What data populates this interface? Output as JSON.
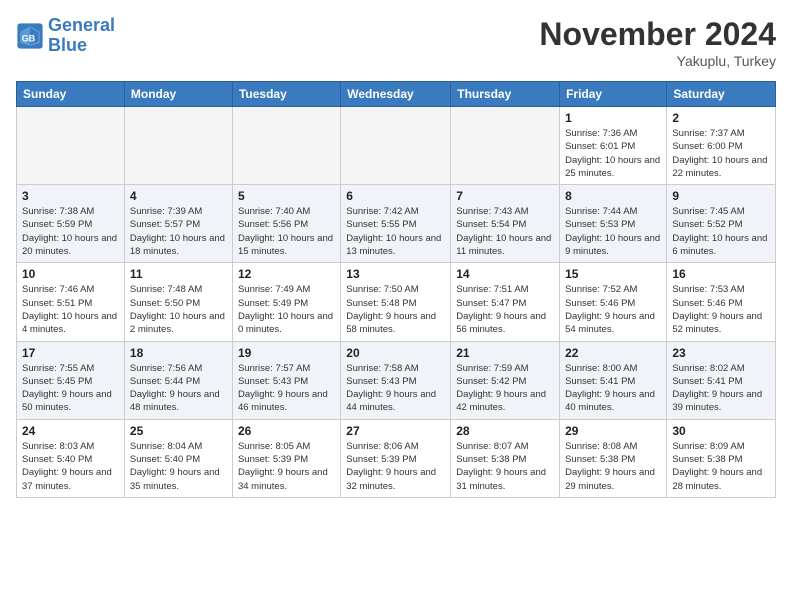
{
  "header": {
    "logo_line1": "General",
    "logo_line2": "Blue",
    "month_title": "November 2024",
    "location": "Yakuplu, Turkey"
  },
  "weekdays": [
    "Sunday",
    "Monday",
    "Tuesday",
    "Wednesday",
    "Thursday",
    "Friday",
    "Saturday"
  ],
  "weeks": [
    [
      {
        "day": "",
        "info": ""
      },
      {
        "day": "",
        "info": ""
      },
      {
        "day": "",
        "info": ""
      },
      {
        "day": "",
        "info": ""
      },
      {
        "day": "",
        "info": ""
      },
      {
        "day": "1",
        "info": "Sunrise: 7:36 AM\nSunset: 6:01 PM\nDaylight: 10 hours and 25 minutes."
      },
      {
        "day": "2",
        "info": "Sunrise: 7:37 AM\nSunset: 6:00 PM\nDaylight: 10 hours and 22 minutes."
      }
    ],
    [
      {
        "day": "3",
        "info": "Sunrise: 7:38 AM\nSunset: 5:59 PM\nDaylight: 10 hours and 20 minutes."
      },
      {
        "day": "4",
        "info": "Sunrise: 7:39 AM\nSunset: 5:57 PM\nDaylight: 10 hours and 18 minutes."
      },
      {
        "day": "5",
        "info": "Sunrise: 7:40 AM\nSunset: 5:56 PM\nDaylight: 10 hours and 15 minutes."
      },
      {
        "day": "6",
        "info": "Sunrise: 7:42 AM\nSunset: 5:55 PM\nDaylight: 10 hours and 13 minutes."
      },
      {
        "day": "7",
        "info": "Sunrise: 7:43 AM\nSunset: 5:54 PM\nDaylight: 10 hours and 11 minutes."
      },
      {
        "day": "8",
        "info": "Sunrise: 7:44 AM\nSunset: 5:53 PM\nDaylight: 10 hours and 9 minutes."
      },
      {
        "day": "9",
        "info": "Sunrise: 7:45 AM\nSunset: 5:52 PM\nDaylight: 10 hours and 6 minutes."
      }
    ],
    [
      {
        "day": "10",
        "info": "Sunrise: 7:46 AM\nSunset: 5:51 PM\nDaylight: 10 hours and 4 minutes."
      },
      {
        "day": "11",
        "info": "Sunrise: 7:48 AM\nSunset: 5:50 PM\nDaylight: 10 hours and 2 minutes."
      },
      {
        "day": "12",
        "info": "Sunrise: 7:49 AM\nSunset: 5:49 PM\nDaylight: 10 hours and 0 minutes."
      },
      {
        "day": "13",
        "info": "Sunrise: 7:50 AM\nSunset: 5:48 PM\nDaylight: 9 hours and 58 minutes."
      },
      {
        "day": "14",
        "info": "Sunrise: 7:51 AM\nSunset: 5:47 PM\nDaylight: 9 hours and 56 minutes."
      },
      {
        "day": "15",
        "info": "Sunrise: 7:52 AM\nSunset: 5:46 PM\nDaylight: 9 hours and 54 minutes."
      },
      {
        "day": "16",
        "info": "Sunrise: 7:53 AM\nSunset: 5:46 PM\nDaylight: 9 hours and 52 minutes."
      }
    ],
    [
      {
        "day": "17",
        "info": "Sunrise: 7:55 AM\nSunset: 5:45 PM\nDaylight: 9 hours and 50 minutes."
      },
      {
        "day": "18",
        "info": "Sunrise: 7:56 AM\nSunset: 5:44 PM\nDaylight: 9 hours and 48 minutes."
      },
      {
        "day": "19",
        "info": "Sunrise: 7:57 AM\nSunset: 5:43 PM\nDaylight: 9 hours and 46 minutes."
      },
      {
        "day": "20",
        "info": "Sunrise: 7:58 AM\nSunset: 5:43 PM\nDaylight: 9 hours and 44 minutes."
      },
      {
        "day": "21",
        "info": "Sunrise: 7:59 AM\nSunset: 5:42 PM\nDaylight: 9 hours and 42 minutes."
      },
      {
        "day": "22",
        "info": "Sunrise: 8:00 AM\nSunset: 5:41 PM\nDaylight: 9 hours and 40 minutes."
      },
      {
        "day": "23",
        "info": "Sunrise: 8:02 AM\nSunset: 5:41 PM\nDaylight: 9 hours and 39 minutes."
      }
    ],
    [
      {
        "day": "24",
        "info": "Sunrise: 8:03 AM\nSunset: 5:40 PM\nDaylight: 9 hours and 37 minutes."
      },
      {
        "day": "25",
        "info": "Sunrise: 8:04 AM\nSunset: 5:40 PM\nDaylight: 9 hours and 35 minutes."
      },
      {
        "day": "26",
        "info": "Sunrise: 8:05 AM\nSunset: 5:39 PM\nDaylight: 9 hours and 34 minutes."
      },
      {
        "day": "27",
        "info": "Sunrise: 8:06 AM\nSunset: 5:39 PM\nDaylight: 9 hours and 32 minutes."
      },
      {
        "day": "28",
        "info": "Sunrise: 8:07 AM\nSunset: 5:38 PM\nDaylight: 9 hours and 31 minutes."
      },
      {
        "day": "29",
        "info": "Sunrise: 8:08 AM\nSunset: 5:38 PM\nDaylight: 9 hours and 29 minutes."
      },
      {
        "day": "30",
        "info": "Sunrise: 8:09 AM\nSunset: 5:38 PM\nDaylight: 9 hours and 28 minutes."
      }
    ]
  ]
}
